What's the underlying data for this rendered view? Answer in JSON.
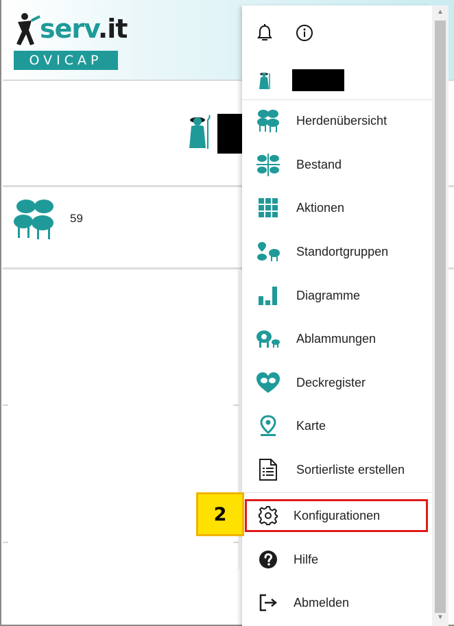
{
  "app": {
    "logo_text": "serv",
    "logo_text_dot": ".it",
    "logo_sub": "OVICAP"
  },
  "overview": {
    "flock_count": "59"
  },
  "menu": {
    "items": [
      {
        "label": "Herdenübersicht",
        "icon": "flock-icon"
      },
      {
        "label": "Bestand",
        "icon": "stock-icon"
      },
      {
        "label": "Aktionen",
        "icon": "grid-icon"
      },
      {
        "label": "Standortgruppen",
        "icon": "location-groups-icon"
      },
      {
        "label": "Diagramme",
        "icon": "bar-chart-icon"
      },
      {
        "label": "Ablammungen",
        "icon": "lambing-icon"
      },
      {
        "label": "Deckregister",
        "icon": "heart-icon"
      },
      {
        "label": "Karte",
        "icon": "map-pin-icon"
      },
      {
        "label": "Sortierliste erstellen",
        "icon": "document-list-icon"
      },
      {
        "label": "Konfigurationen",
        "icon": "gear-icon"
      },
      {
        "label": "Hilfe",
        "icon": "help-icon"
      },
      {
        "label": "Abmelden",
        "icon": "logout-icon"
      }
    ],
    "highlighted_item": "Konfigurationen"
  },
  "annotation": {
    "step": "2"
  },
  "colors": {
    "brand": "#1f9a99",
    "highlight": "#e01a1a",
    "badge": "#ffe100"
  }
}
